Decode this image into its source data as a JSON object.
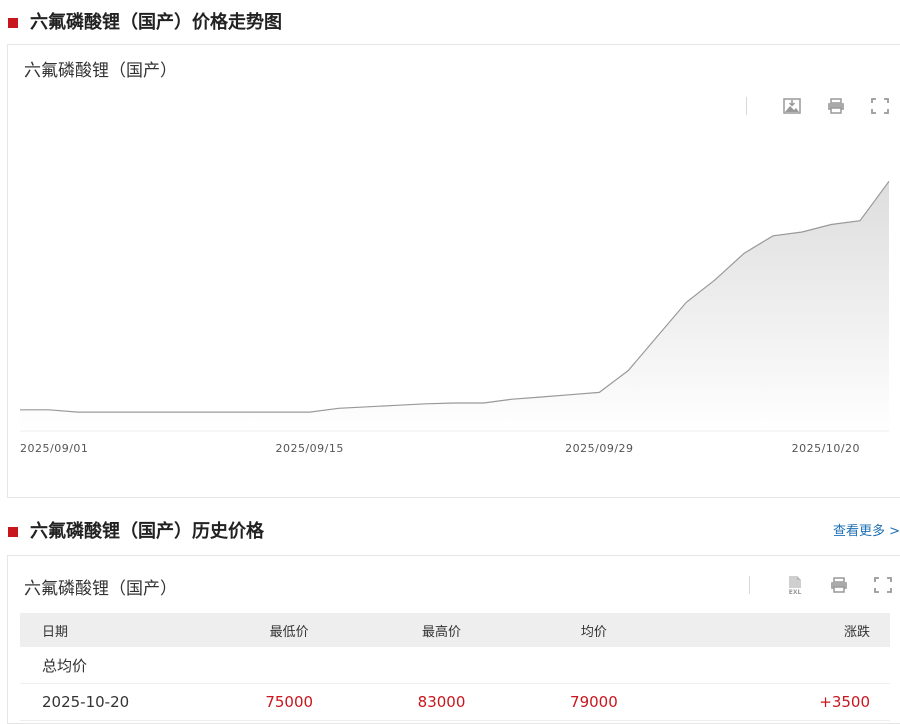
{
  "trend_section": {
    "title": "六氟磷酸锂（国产）价格走势图",
    "panel_title": "六氟磷酸锂（国产）",
    "toolbar": {
      "icons": [
        "download-image-icon",
        "print-icon",
        "fullscreen-icon"
      ]
    },
    "chart_data": {
      "type": "area",
      "title": "六氟磷酸锂（国产）",
      "xlabel": "",
      "ylabel": "",
      "x_ticks": [
        "2025/09/01",
        "2025/09/15",
        "2025/09/29",
        "2025/10/20"
      ],
      "x": [
        "2025/09/01",
        "2025/09/02",
        "2025/09/03",
        "2025/09/04",
        "2025/09/05",
        "2025/09/08",
        "2025/09/09",
        "2025/09/10",
        "2025/09/11",
        "2025/09/12",
        "2025/09/15",
        "2025/09/16",
        "2025/09/17",
        "2025/09/18",
        "2025/09/19",
        "2025/09/22",
        "2025/09/23",
        "2025/09/24",
        "2025/09/25",
        "2025/09/26",
        "2025/09/29",
        "2025/09/30",
        "2025/10/09",
        "2025/10/10",
        "2025/10/13",
        "2025/10/14",
        "2025/10/15",
        "2025/10/16",
        "2025/10/17",
        "2025/10/20"
      ],
      "values": [
        52800,
        52800,
        52500,
        52500,
        52500,
        52500,
        52500,
        52500,
        52500,
        52500,
        52500,
        53000,
        53200,
        53400,
        53600,
        53700,
        53700,
        54200,
        54500,
        54800,
        55100,
        58000,
        62500,
        67000,
        70000,
        73500,
        75800,
        76300,
        77300,
        77800,
        83000
      ],
      "grid": false,
      "legend": "none",
      "line_color": "#999999",
      "fill_color": "#e6e6e6"
    }
  },
  "history_section": {
    "title": "六氟磷酸锂（国产）历史价格",
    "more_link": "查看更多 >",
    "panel_title": "六氟磷酸锂（国产）",
    "toolbar": {
      "icons": [
        "excel-export-icon",
        "print-icon",
        "fullscreen-icon"
      ]
    },
    "table": {
      "headers": [
        "日期",
        "最低价",
        "最高价",
        "均价",
        "涨跌"
      ],
      "summary_row": {
        "label": "总均价"
      },
      "rows": [
        {
          "date": "2025-10-20",
          "low": "75000",
          "high": "83000",
          "avg": "79000",
          "change": "+3500"
        }
      ]
    }
  },
  "colors": {
    "accent": "#c8161d",
    "link": "#1e6fb5",
    "header_bg": "#eeeeee"
  }
}
